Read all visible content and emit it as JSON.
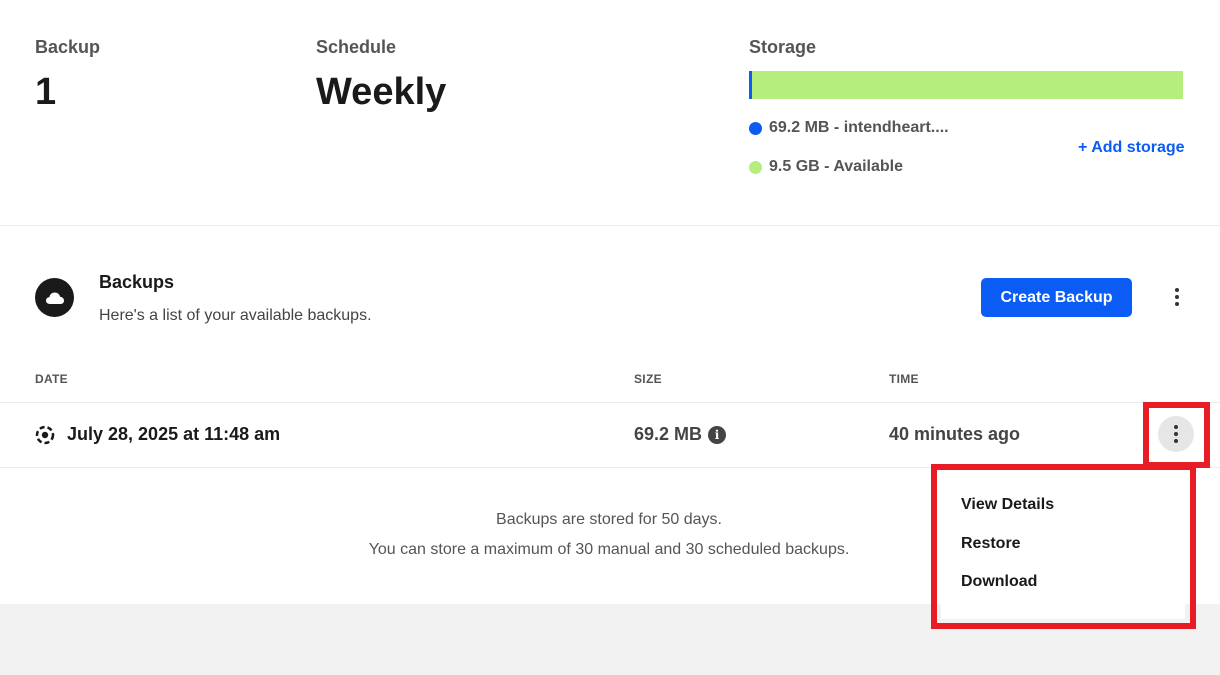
{
  "stats": {
    "backup_label": "Backup",
    "backup_value": "1",
    "schedule_label": "Schedule",
    "schedule_value": "Weekly",
    "storage_label": "Storage"
  },
  "storage": {
    "used_text": "69.2 MB - intendheart....",
    "available_text": "9.5 GB - Available",
    "add_storage_label": "+ Add storage",
    "used_fraction": 0.007,
    "used_color": "#0b5cf5",
    "available_color": "#b5ee7d"
  },
  "backups": {
    "title": "Backups",
    "subtitle": "Here's a list of your available backups.",
    "create_button_label": "Create Backup",
    "icon": "cloud-icon",
    "columns": [
      "DATE",
      "SIZE",
      "TIME"
    ],
    "rows": [
      {
        "date": "July 28, 2025 at 11:48 am",
        "size": "69.2 MB",
        "time": "40 minutes ago",
        "icon": "backup-type-icon"
      }
    ],
    "note_line1": "Backups are stored for 50 days.",
    "note_line2": "You can store a maximum of 30 manual and 30 scheduled backups."
  },
  "row_menu": {
    "items": [
      "View Details",
      "Restore",
      "Download"
    ]
  },
  "colors": {
    "accent": "#0b5cf5",
    "highlight": "#e81c24"
  }
}
